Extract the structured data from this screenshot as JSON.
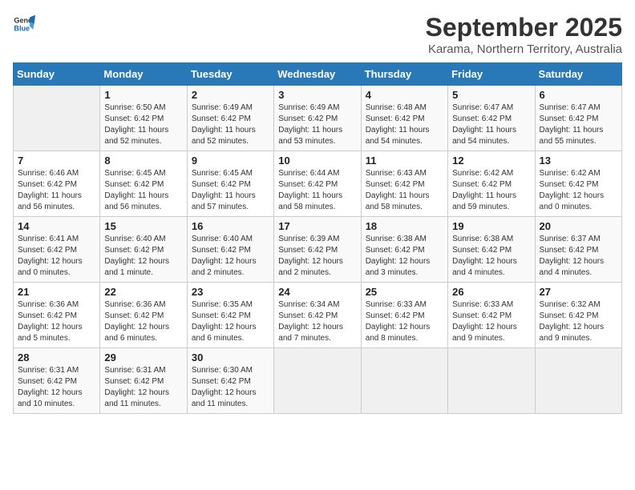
{
  "logo": {
    "text_general": "General",
    "text_blue": "Blue"
  },
  "title": "September 2025",
  "subtitle": "Karama, Northern Territory, Australia",
  "days_of_week": [
    "Sunday",
    "Monday",
    "Tuesday",
    "Wednesday",
    "Thursday",
    "Friday",
    "Saturday"
  ],
  "weeks": [
    [
      {
        "day": "",
        "info": ""
      },
      {
        "day": "1",
        "info": "Sunrise: 6:50 AM\nSunset: 6:42 PM\nDaylight: 11 hours\nand 52 minutes."
      },
      {
        "day": "2",
        "info": "Sunrise: 6:49 AM\nSunset: 6:42 PM\nDaylight: 11 hours\nand 52 minutes."
      },
      {
        "day": "3",
        "info": "Sunrise: 6:49 AM\nSunset: 6:42 PM\nDaylight: 11 hours\nand 53 minutes."
      },
      {
        "day": "4",
        "info": "Sunrise: 6:48 AM\nSunset: 6:42 PM\nDaylight: 11 hours\nand 54 minutes."
      },
      {
        "day": "5",
        "info": "Sunrise: 6:47 AM\nSunset: 6:42 PM\nDaylight: 11 hours\nand 54 minutes."
      },
      {
        "day": "6",
        "info": "Sunrise: 6:47 AM\nSunset: 6:42 PM\nDaylight: 11 hours\nand 55 minutes."
      }
    ],
    [
      {
        "day": "7",
        "info": "Sunrise: 6:46 AM\nSunset: 6:42 PM\nDaylight: 11 hours\nand 56 minutes."
      },
      {
        "day": "8",
        "info": "Sunrise: 6:45 AM\nSunset: 6:42 PM\nDaylight: 11 hours\nand 56 minutes."
      },
      {
        "day": "9",
        "info": "Sunrise: 6:45 AM\nSunset: 6:42 PM\nDaylight: 11 hours\nand 57 minutes."
      },
      {
        "day": "10",
        "info": "Sunrise: 6:44 AM\nSunset: 6:42 PM\nDaylight: 11 hours\nand 58 minutes."
      },
      {
        "day": "11",
        "info": "Sunrise: 6:43 AM\nSunset: 6:42 PM\nDaylight: 11 hours\nand 58 minutes."
      },
      {
        "day": "12",
        "info": "Sunrise: 6:42 AM\nSunset: 6:42 PM\nDaylight: 11 hours\nand 59 minutes."
      },
      {
        "day": "13",
        "info": "Sunrise: 6:42 AM\nSunset: 6:42 PM\nDaylight: 12 hours\nand 0 minutes."
      }
    ],
    [
      {
        "day": "14",
        "info": "Sunrise: 6:41 AM\nSunset: 6:42 PM\nDaylight: 12 hours\nand 0 minutes."
      },
      {
        "day": "15",
        "info": "Sunrise: 6:40 AM\nSunset: 6:42 PM\nDaylight: 12 hours\nand 1 minute."
      },
      {
        "day": "16",
        "info": "Sunrise: 6:40 AM\nSunset: 6:42 PM\nDaylight: 12 hours\nand 2 minutes."
      },
      {
        "day": "17",
        "info": "Sunrise: 6:39 AM\nSunset: 6:42 PM\nDaylight: 12 hours\nand 2 minutes."
      },
      {
        "day": "18",
        "info": "Sunrise: 6:38 AM\nSunset: 6:42 PM\nDaylight: 12 hours\nand 3 minutes."
      },
      {
        "day": "19",
        "info": "Sunrise: 6:38 AM\nSunset: 6:42 PM\nDaylight: 12 hours\nand 4 minutes."
      },
      {
        "day": "20",
        "info": "Sunrise: 6:37 AM\nSunset: 6:42 PM\nDaylight: 12 hours\nand 4 minutes."
      }
    ],
    [
      {
        "day": "21",
        "info": "Sunrise: 6:36 AM\nSunset: 6:42 PM\nDaylight: 12 hours\nand 5 minutes."
      },
      {
        "day": "22",
        "info": "Sunrise: 6:36 AM\nSunset: 6:42 PM\nDaylight: 12 hours\nand 6 minutes."
      },
      {
        "day": "23",
        "info": "Sunrise: 6:35 AM\nSunset: 6:42 PM\nDaylight: 12 hours\nand 6 minutes."
      },
      {
        "day": "24",
        "info": "Sunrise: 6:34 AM\nSunset: 6:42 PM\nDaylight: 12 hours\nand 7 minutes."
      },
      {
        "day": "25",
        "info": "Sunrise: 6:33 AM\nSunset: 6:42 PM\nDaylight: 12 hours\nand 8 minutes."
      },
      {
        "day": "26",
        "info": "Sunrise: 6:33 AM\nSunset: 6:42 PM\nDaylight: 12 hours\nand 9 minutes."
      },
      {
        "day": "27",
        "info": "Sunrise: 6:32 AM\nSunset: 6:42 PM\nDaylight: 12 hours\nand 9 minutes."
      }
    ],
    [
      {
        "day": "28",
        "info": "Sunrise: 6:31 AM\nSunset: 6:42 PM\nDaylight: 12 hours\nand 10 minutes."
      },
      {
        "day": "29",
        "info": "Sunrise: 6:31 AM\nSunset: 6:42 PM\nDaylight: 12 hours\nand 11 minutes."
      },
      {
        "day": "30",
        "info": "Sunrise: 6:30 AM\nSunset: 6:42 PM\nDaylight: 12 hours\nand 11 minutes."
      },
      {
        "day": "",
        "info": ""
      },
      {
        "day": "",
        "info": ""
      },
      {
        "day": "",
        "info": ""
      },
      {
        "day": "",
        "info": ""
      }
    ]
  ]
}
